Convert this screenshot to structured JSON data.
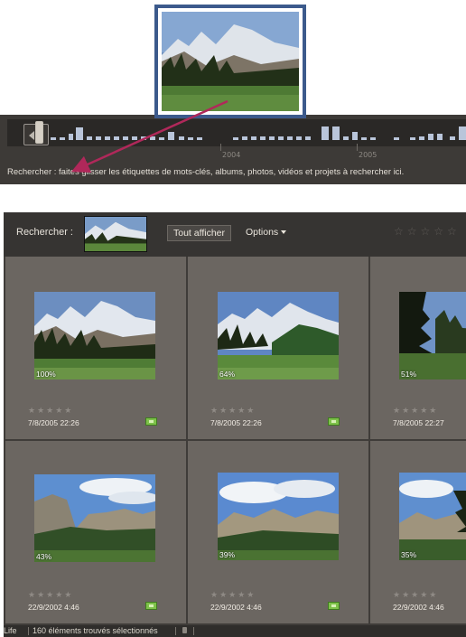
{
  "timeline": {
    "years": [
      "2004",
      "2005"
    ]
  },
  "search_hint": "Rechercher : faites glisser les étiquettes de mots-clés, albums, photos, vidéos et projets à rechercher ici.",
  "find_bar": {
    "label": "Rechercher :",
    "show_all": "Tout afficher",
    "options": "Options",
    "rating_filter": "☆☆☆☆☆"
  },
  "grid": {
    "items": [
      {
        "match": "100%",
        "stars": "★★★★★",
        "date": "7/8/2005 22:26",
        "scene": "mountain"
      },
      {
        "match": "64%",
        "stars": "★★★★★",
        "date": "7/8/2005 22:26",
        "scene": "mountain"
      },
      {
        "match": "51%",
        "stars": "★★★★★",
        "date": "7/8/2005 22:27",
        "scene": "forest"
      },
      {
        "match": "43%",
        "stars": "★★★★★",
        "date": "22/9/2002 4:46",
        "scene": "valley"
      },
      {
        "match": "39%",
        "stars": "★★★★★",
        "date": "22/9/2002 4:46",
        "scene": "valley"
      },
      {
        "match": "35%",
        "stars": "★★★★★",
        "date": "22/9/2002 4:46",
        "scene": "valley"
      }
    ]
  },
  "status_bar": {
    "left": "Life",
    "count": "160 éléments trouvés sélectionnés"
  },
  "colors": {
    "accent_frame": "#3c5a8c",
    "arrow": "#b0285a",
    "badge": "#7ec24a"
  }
}
